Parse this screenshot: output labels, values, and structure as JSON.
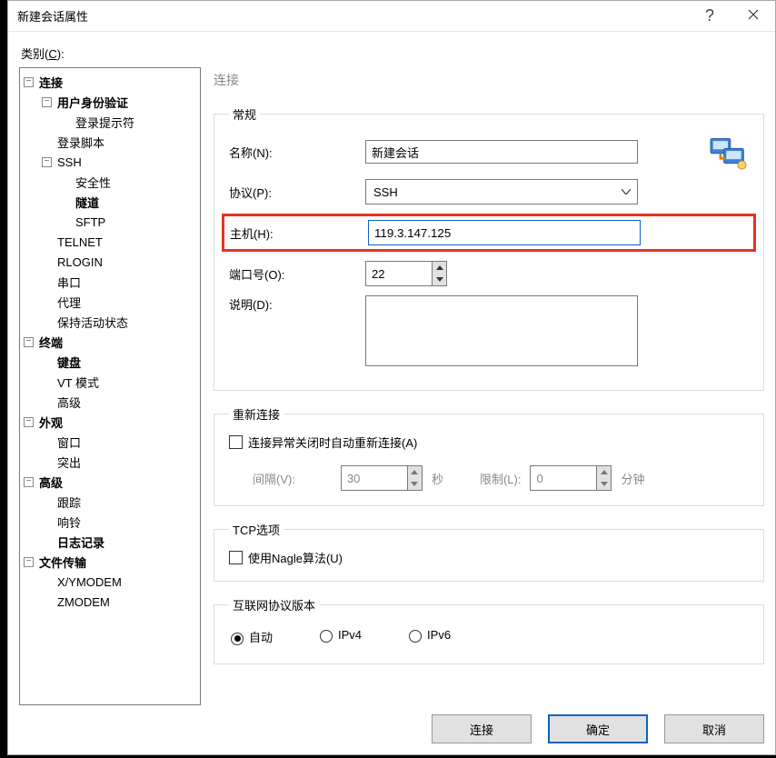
{
  "window": {
    "title": "新建会话属性",
    "help": "?"
  },
  "labels": {
    "category": "类别(",
    "category_u": "C",
    "category_close": "):"
  },
  "tree": {
    "connection": "连接",
    "user_auth": "用户身份验证",
    "login_prompt": "登录提示符",
    "login_script": "登录脚本",
    "ssh": "SSH",
    "security": "安全性",
    "tunnel": "隧道",
    "sftp": "SFTP",
    "telnet": "TELNET",
    "rlogin": "RLOGIN",
    "serial": "串口",
    "proxy": "代理",
    "keepalive": "保持活动状态",
    "terminal": "终端",
    "keyboard": "键盘",
    "vt_mode": "VT 模式",
    "advanced_term": "高级",
    "appearance": "外观",
    "window": "窗口",
    "highlight": "突出",
    "advanced": "高级",
    "trace": "跟踪",
    "bell": "响铃",
    "logging": "日志记录",
    "file_transfer": "文件传输",
    "xymodem": "X/YMODEM",
    "zmodem": "ZMODEM"
  },
  "panel": {
    "title": "连接",
    "general": {
      "legend": "常规",
      "name_label": "名称(N):",
      "name_value": "新建会话",
      "protocol_label": "协议(P):",
      "protocol_value": "SSH",
      "host_label": "主机(H):",
      "host_value": "119.3.147.125",
      "port_label": "端口号(O):",
      "port_value": "22",
      "desc_label": "说明(D):",
      "desc_value": ""
    },
    "reconnect": {
      "legend": "重新连接",
      "chk_label": "连接异常关闭时自动重新连接(A)",
      "interval_label": "间隔(V):",
      "interval_value": "30",
      "interval_unit": "秒",
      "limit_label": "限制(L):",
      "limit_value": "0",
      "limit_unit": "分钟"
    },
    "tcp": {
      "legend": "TCP选项",
      "nagle_label": "使用Nagle算法(U)"
    },
    "ipver": {
      "legend": "互联网协议版本",
      "auto": "自动",
      "ipv4": "IPv4",
      "ipv6": "IPv6"
    }
  },
  "buttons": {
    "connect": "连接",
    "ok": "确定",
    "cancel": "取消"
  }
}
